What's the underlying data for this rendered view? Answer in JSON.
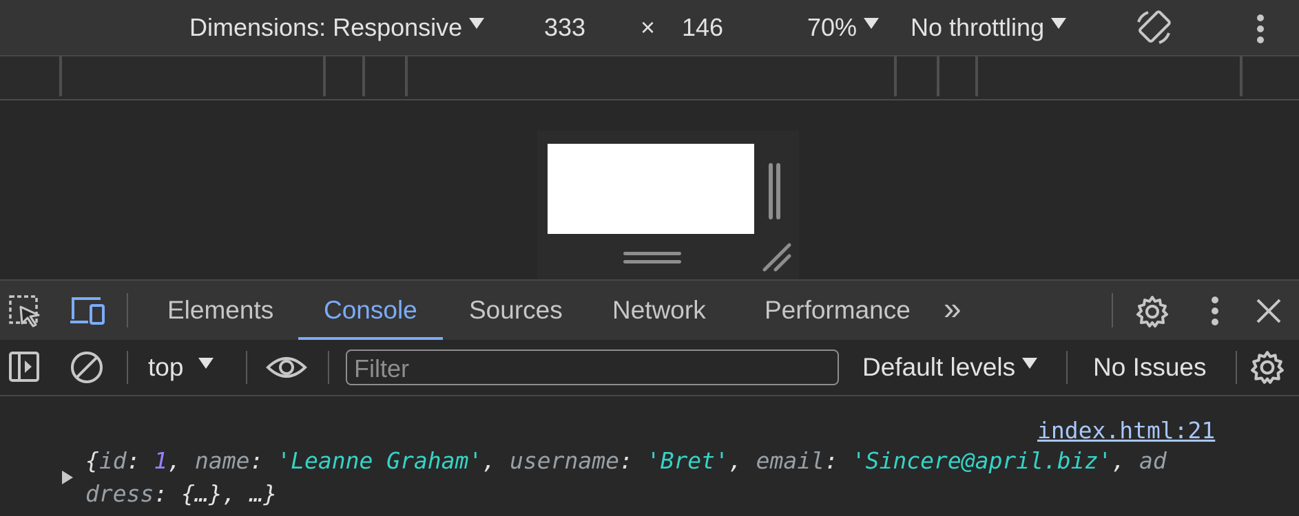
{
  "device_toolbar": {
    "dimensions_label": "Dimensions: Responsive",
    "width": "333",
    "times": "×",
    "height": "146",
    "zoom": "70%",
    "throttling": "No throttling"
  },
  "tabs": [
    {
      "label": "Elements"
    },
    {
      "label": "Console"
    },
    {
      "label": "Sources"
    },
    {
      "label": "Network"
    },
    {
      "label": "Performance"
    }
  ],
  "more_tabs_glyph": "»",
  "active_tab": "Console",
  "console_toolbar": {
    "context": "top",
    "filter_placeholder": "Filter",
    "levels": "Default levels",
    "issues": "No Issues"
  },
  "log": {
    "source": "index.html:21",
    "tokens": {
      "open": "{",
      "k_id": "id",
      "v_id": "1",
      "k_name": "name",
      "v_name": "'Leanne Graham'",
      "k_username": "username",
      "v_username": "'Bret'",
      "k_email": "email",
      "v_email": "'Sincere@april.biz'",
      "k_address_1": "ad",
      "k_address_2": "dress",
      "v_address": "{…}",
      "tail": "…}"
    }
  },
  "colors": {
    "accent": "#7cacf8",
    "string": "#35d4c7",
    "number": "#9980ff"
  }
}
